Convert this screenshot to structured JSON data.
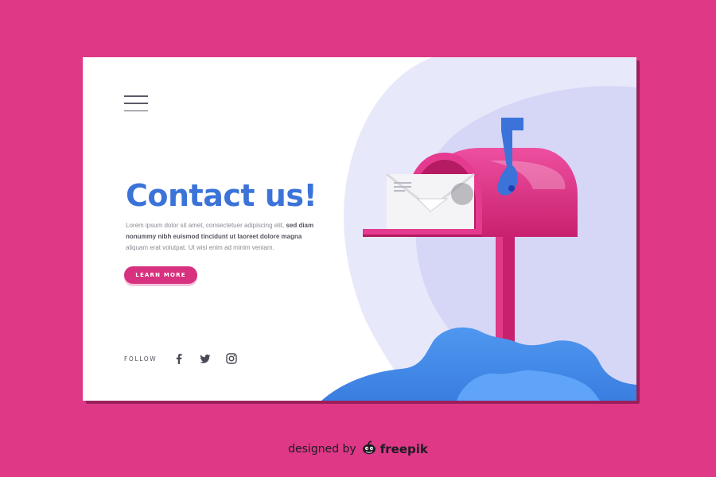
{
  "page": {
    "background_color": "#de3886",
    "accent_blue": "#3b73d9",
    "accent_pink": "#d8317f"
  },
  "header": {
    "menu_icon": "hamburger-icon"
  },
  "hero": {
    "title": "Contact us!",
    "body": [
      {
        "text": "Lorem ipsum dolor sit amet, consectetuer adipiscing elit, ",
        "bold": false
      },
      {
        "text": "sed diam nonummy nibh euismod tincidunt ut laoreet dolore magna",
        "bold": true
      },
      {
        "text": " aliquam erat volutpat. Ut wisi enim ad minim veniam.",
        "bold": false
      }
    ],
    "cta_label": "LEARN MORE"
  },
  "follow": {
    "label": "FOLLOW",
    "icons": [
      "facebook-icon",
      "twitter-icon",
      "instagram-icon"
    ]
  },
  "illustration": {
    "subject": "mailbox-with-letter",
    "icons": [
      "mailbox-icon",
      "envelope-icon",
      "mailbox-flag-icon"
    ]
  },
  "credit": {
    "text": "designed by",
    "brand": "freepik",
    "icon": "freepik-logo-icon"
  }
}
